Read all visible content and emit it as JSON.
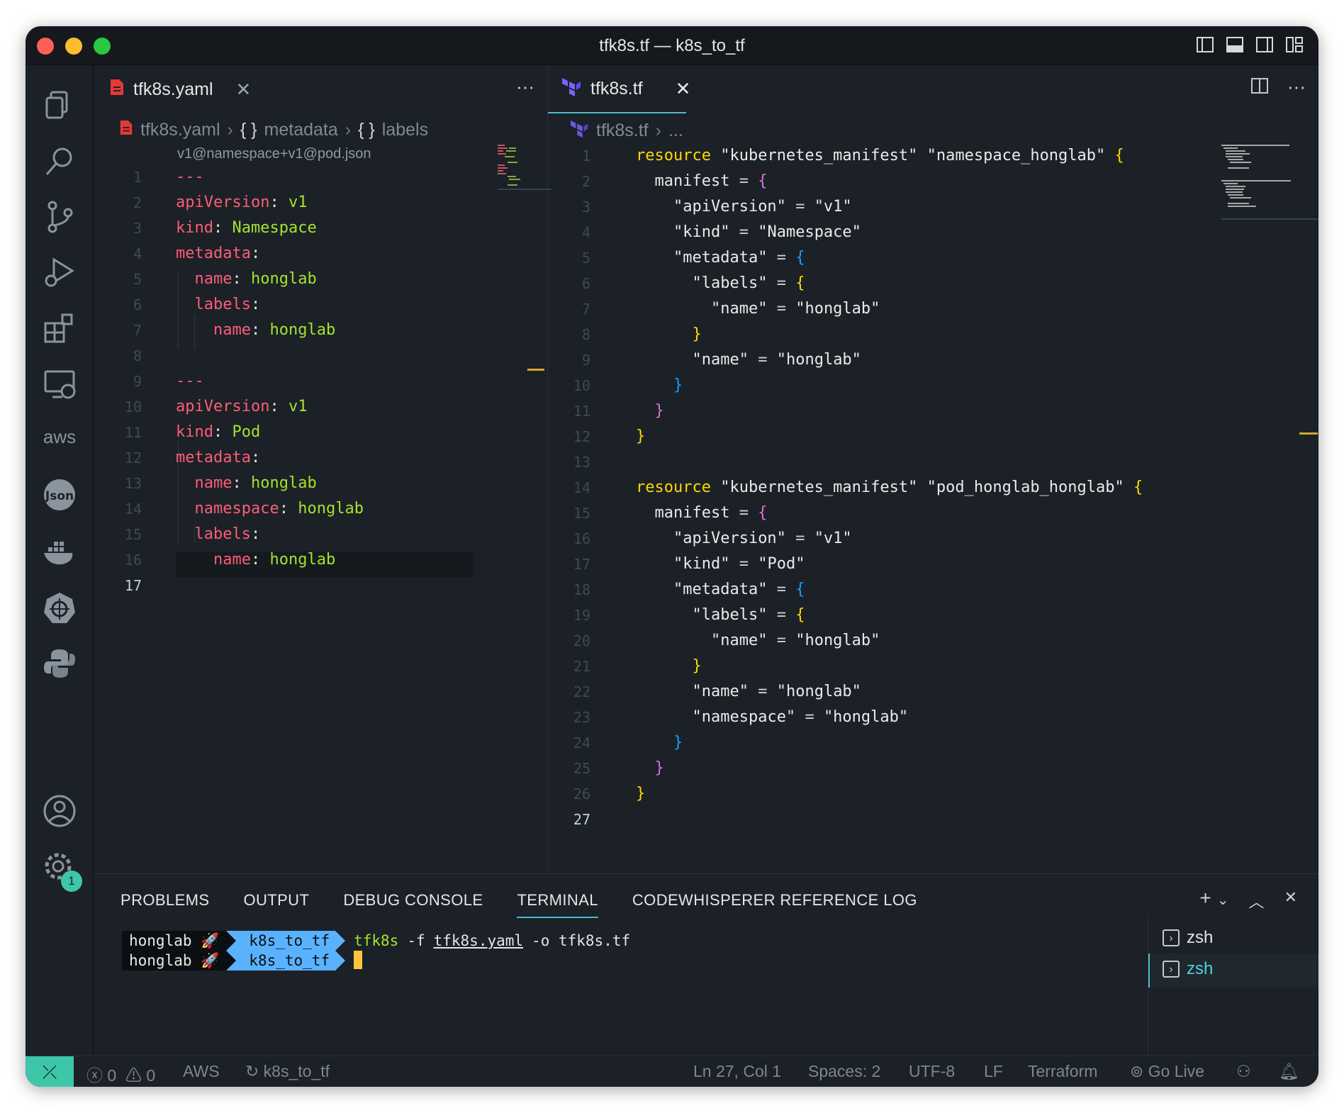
{
  "window": {
    "title": "tfk8s.tf — k8s_to_tf"
  },
  "activity_bar": {
    "items": [
      "explorer-icon",
      "search-icon",
      "source-control-icon",
      "run-debug-icon",
      "extensions-icon",
      "remote-explorer-icon",
      "aws-icon",
      "json-icon",
      "docker-icon",
      "kubernetes-icon",
      "python-icon"
    ],
    "aws_label": "aws",
    "json_label": "Json",
    "settings_badge": "1"
  },
  "left_editor": {
    "tab_label": "tfk8s.yaml",
    "breadcrumb": {
      "file": "tfk8s.yaml",
      "seg1": "metadata",
      "seg2": "labels",
      "brace": "{ }"
    },
    "hint": "v1@namespace+v1@pod.json",
    "current_line": "17",
    "line_numbers": [
      "1",
      "2",
      "3",
      "4",
      "5",
      "6",
      "7",
      "8",
      "9",
      "10",
      "11",
      "12",
      "13",
      "14",
      "15",
      "16",
      "17"
    ]
  },
  "right_editor": {
    "tab_label": "tfk8s.tf",
    "breadcrumb": {
      "file": "tfk8s.tf",
      "ellipsis": "..."
    },
    "current_line": "27",
    "line_numbers": [
      "1",
      "2",
      "3",
      "4",
      "5",
      "6",
      "7",
      "8",
      "9",
      "10",
      "11",
      "12",
      "13",
      "14",
      "15",
      "16",
      "17",
      "18",
      "19",
      "20",
      "21",
      "22",
      "23",
      "24",
      "25",
      "26",
      "27"
    ]
  },
  "panel": {
    "tabs": [
      "PROBLEMS",
      "OUTPUT",
      "DEBUG CONSOLE",
      "TERMINAL",
      "CODEWHISPERER REFERENCE LOG"
    ],
    "active_tab": "TERMINAL",
    "terminal": {
      "user": "honglab 🚀",
      "dir": "k8s_to_tf",
      "command": "tfk8s -f tfk8s.yaml -o tfk8s.tf",
      "cmd_name": "tfk8s",
      "cmd_flag1": "-f",
      "cmd_file": "tfk8s.yaml",
      "cmd_flag2": "-o tfk8s.tf"
    },
    "terminal_list": [
      "zsh",
      "zsh"
    ]
  },
  "status_bar": {
    "errors": "0",
    "warnings": "0",
    "aws": "AWS",
    "branch": "k8s_to_tf",
    "position": "Ln 27, Col 1",
    "spaces": "Spaces: 2",
    "encoding": "UTF-8",
    "eol": "LF",
    "language": "Terraform",
    "go_live": "Go Live"
  },
  "colors": {
    "accent": "#4fb8cc",
    "remote": "#3ec6a8",
    "yaml_key": "#ff5c77",
    "yaml_value": "#a6e22e",
    "bracket_gold": "#ffd700",
    "bracket_pink": "#da70d6",
    "bracket_blue": "#179fff"
  }
}
